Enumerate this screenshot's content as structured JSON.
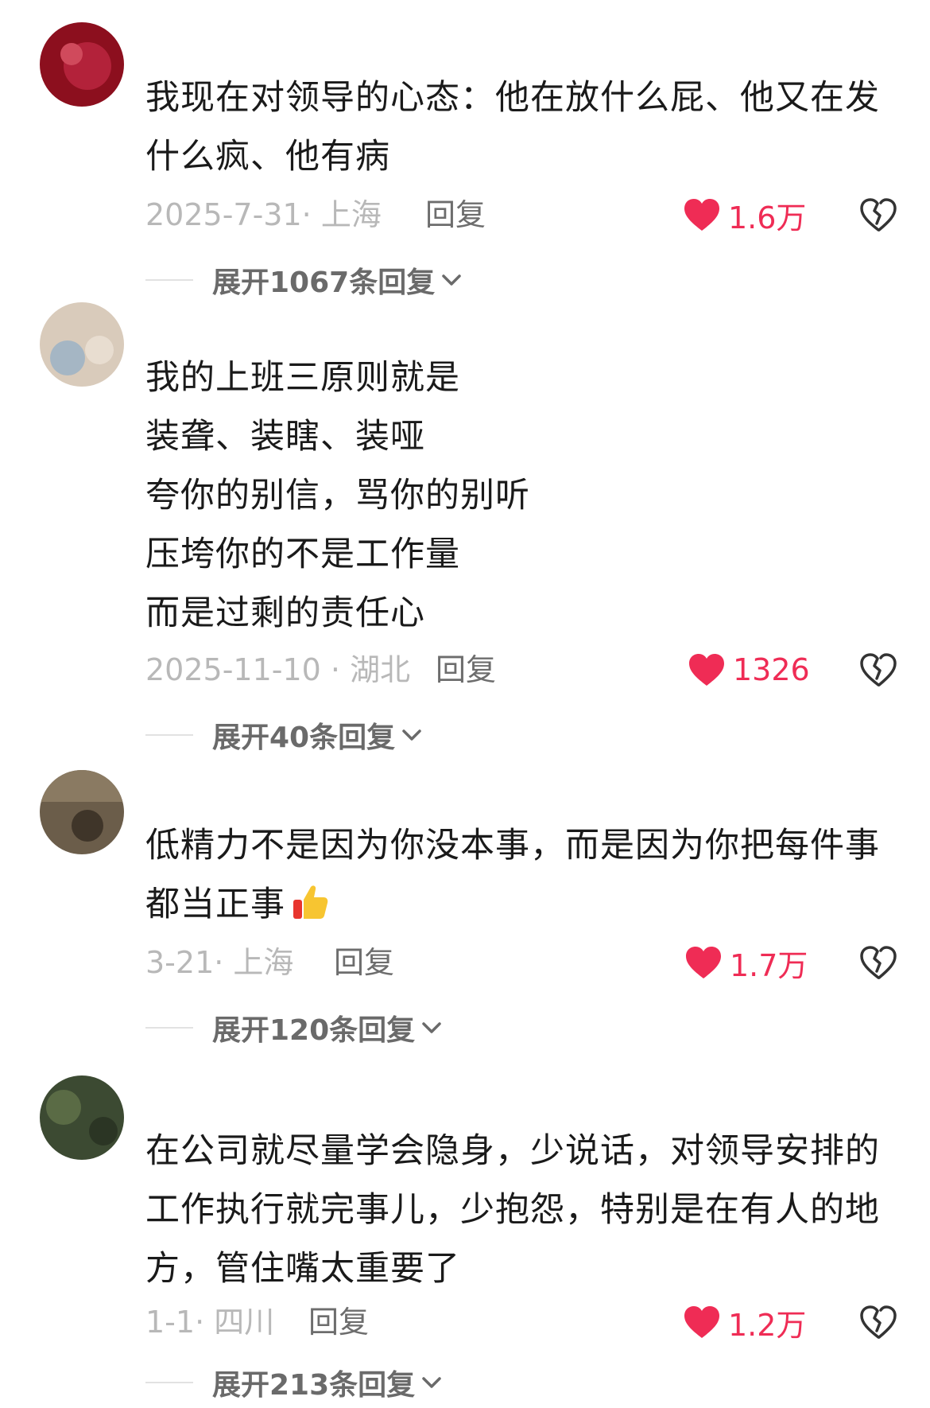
{
  "comments": [
    {
      "text": "我现在对领导的心态：他在放什么屁、他又在发\n什么疯、他有病",
      "meta": "2025-7-31· 上海",
      "reply_label": "回复",
      "likes": "1.6万",
      "expand_label": "展开1067条回复",
      "avatar_color": "#8c0f1e"
    },
    {
      "text": "我的上班三原则就是\n装聋、装瞎、装哑\n夸你的别信，骂你的别听\n压垮你的不是工作量\n而是过剩的责任心",
      "meta": "2025-11-10 · 湖北",
      "reply_label": "回复",
      "likes": "1326",
      "expand_label": "展开40条回复",
      "avatar_color": "#c9b8a6"
    },
    {
      "text": "低精力不是因为你没本事，而是因为你把每件事\n都当正事",
      "meta": "3-21· 上海",
      "reply_label": "回复",
      "likes": "1.7万",
      "expand_label": "展开120条回复",
      "avatar_color": "#5a4e3e"
    },
    {
      "text": "在公司就尽量学会隐身，少说话，对领导安排的\n工作执行就完事儿，少抱怨，特别是在有人的地\n方，管住嘴太重要了",
      "meta": "1-1· 四川",
      "reply_label": "回复",
      "likes": "1.2万",
      "expand_label": "展开213条回复",
      "avatar_color": "#3c4a32"
    }
  ],
  "icons": {
    "like": "heart-icon",
    "dislike": "broken-heart-icon",
    "expand": "chevron-down-icon",
    "emoji": "thumbs-up-emoji"
  },
  "colors": {
    "like_red": "#ef2c55",
    "meta_gray": "#b8b8b8",
    "text": "#1a1a1a"
  }
}
